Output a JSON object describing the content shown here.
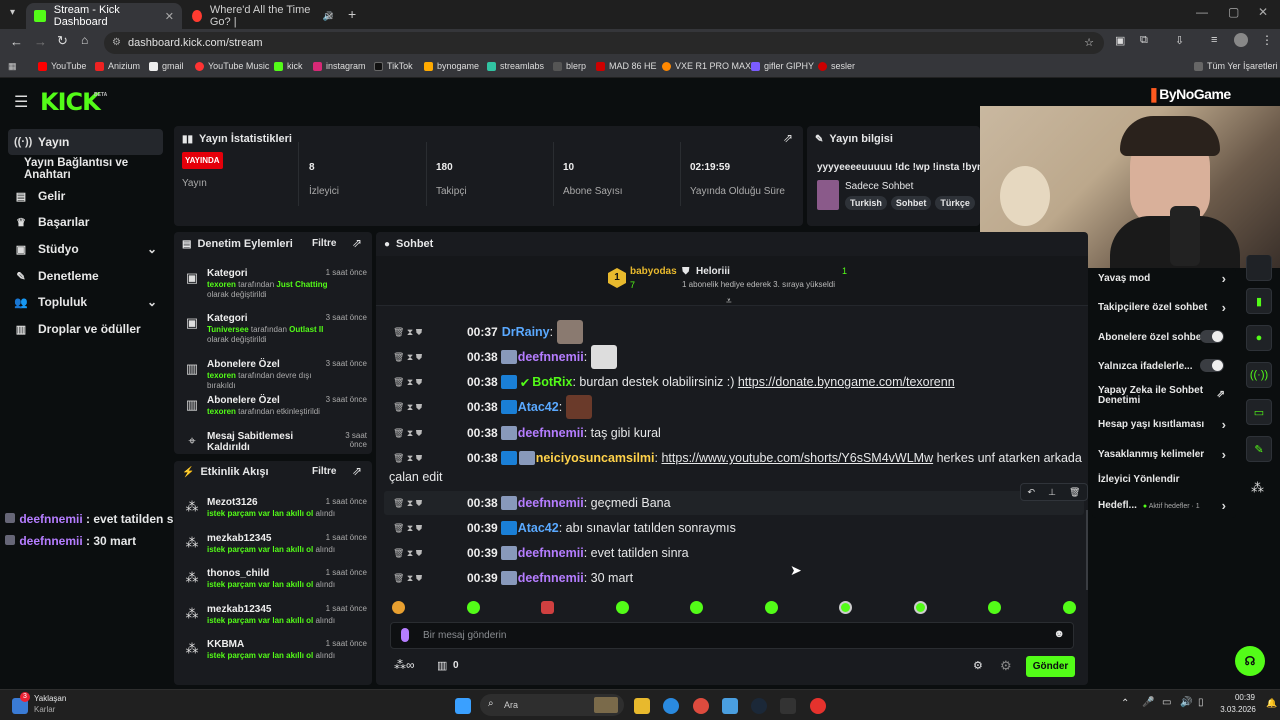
{
  "browser": {
    "tabs": [
      {
        "title": "Stream - Kick Dashboard",
        "color": "#53fc18"
      },
      {
        "title": "Where'd All the Time Go? |",
        "color": "#ff3b30"
      }
    ],
    "url": "dashboard.kick.com/stream",
    "bookmarks": [
      "YouTube",
      "Anizium",
      "gmail",
      "YouTube Music",
      "kick",
      "instagram",
      "TikTok",
      "bynogame",
      "streamlabs",
      "blerp",
      "MAD 86 HE",
      "VXE R1 PRO MAX",
      "gifler GIPHY",
      "sesler"
    ],
    "all_bookmarks": "Tüm Yer İşaretleri"
  },
  "header": {
    "logo": "KICK",
    "logo_tag": "BETA",
    "overlay_brand": "ByNoGame"
  },
  "sidebar": {
    "items": [
      {
        "label": "Yayın",
        "icon": "broadcast-icon"
      },
      {
        "label": "Yayın Bağlantısı ve Anahtarı"
      },
      {
        "label": "Gelir",
        "icon": "wallet-icon"
      },
      {
        "label": "Başarılar",
        "icon": "trophy-icon"
      },
      {
        "label": "Stüdyo",
        "icon": "studio-icon"
      },
      {
        "label": "Denetleme",
        "icon": "wrench-icon"
      },
      {
        "label": "Topluluk",
        "icon": "people-icon"
      },
      {
        "label": "Droplar ve ödüller",
        "icon": "gift-icon"
      }
    ]
  },
  "stats": {
    "title": "Yayın İstatistikleri",
    "live_badge": "YAYINDA",
    "live_label": "Yayın",
    "items": [
      {
        "value": "8",
        "label": "İzleyici"
      },
      {
        "value": "180",
        "label": "Takipçi"
      },
      {
        "value": "10",
        "label": "Abone Sayısı"
      },
      {
        "value": "02:19:59",
        "label": "Yayında Olduğu Süre"
      }
    ]
  },
  "info": {
    "title": "Yayın bilgisi",
    "stream_title": "yyyyeeeeuuuuu !dc !wp !insta !byno",
    "category": "Sadece Sohbet",
    "tags": [
      "Turkish",
      "Sohbet",
      "Türkçe"
    ]
  },
  "mod": {
    "title": "Denetim Eylemleri",
    "filter": "Filtre",
    "items": [
      {
        "title": "Kategori",
        "user": "texoren",
        "mid": " tarafından ",
        "target": "Just Chatting",
        "end": " olarak değiştirildi",
        "time": "1 saat önce"
      },
      {
        "title": "Kategori",
        "user": "Tuniversee",
        "mid": " tarafından ",
        "target": "Outlast II",
        "end": " olarak değiştirildi",
        "time": "3 saat önce"
      },
      {
        "title": "Abonelere Özel",
        "user": "texoren",
        "mid": " tarafından devre dışı bırakıldı",
        "target": "",
        "end": "",
        "time": "3 saat önce"
      },
      {
        "title": "Abonelere Özel",
        "user": "texoren",
        "mid": " tarafından etkinleştirildi",
        "target": "",
        "end": "",
        "time": "3 saat önce"
      },
      {
        "title": "Mesaj Sabitlemesi Kaldırıldı",
        "user": "",
        "mid": "",
        "target": "",
        "end": "",
        "time": "3 saat önce"
      }
    ]
  },
  "activity": {
    "title": "Etkinlik Akışı",
    "filter": "Filtre",
    "items": [
      {
        "name": "Mezot3126",
        "desc": "istek parçam var lan akıllı ol",
        "suffix": " alındı",
        "time": "1 saat önce"
      },
      {
        "name": "mezkab12345",
        "desc": "istek parçam var lan akıllı ol",
        "suffix": " alındı",
        "time": "1 saat önce"
      },
      {
        "name": "thonos_child",
        "desc": "istek parçam var lan akıllı ol",
        "suffix": " alındı",
        "time": "1 saat önce"
      },
      {
        "name": "mezkab12345",
        "desc": "istek parçam var lan akıllı ol",
        "suffix": " alındı",
        "time": "1 saat önce"
      },
      {
        "name": "KKBMA",
        "desc": "istek parçam var lan akıllı ol",
        "suffix": " alındı",
        "time": "1 saat önce"
      }
    ]
  },
  "overlay_chat": [
    {
      "user": "deefnnemii",
      "text": " : evet tatilden sinra"
    },
    {
      "user": "deefnnemii",
      "text": " : 30 mart"
    }
  ],
  "chat": {
    "title": "Sohbet",
    "leader1": {
      "rank": "1",
      "name": "babyodas",
      "count": "7"
    },
    "leader2": {
      "name": "Heloriii",
      "count": "1",
      "desc": "1 abonelik hediye ederek 3. sıraya yükseldi"
    },
    "messages": [
      {
        "time": "00:37",
        "user": "DrRainy",
        "color": "#5aa9ff",
        "text": "",
        "emote": true
      },
      {
        "time": "00:38",
        "user": "deefnnemii",
        "color": "#b57dff",
        "text": "",
        "emote": true
      },
      {
        "time": "00:38",
        "user": "BotRix",
        "color": "#53fc18",
        "text": " burdan destek olabilirsiniz :) ",
        "link": "https://donate.bynogame.com/texorenn"
      },
      {
        "time": "00:38",
        "user": "Atac42",
        "color": "#5aa9ff",
        "text": "",
        "emote": true
      },
      {
        "time": "00:38",
        "user": "deefnnemii",
        "color": "#b57dff",
        "text": " taş gibi kural"
      },
      {
        "time": "00:38",
        "user": "neiciyosuncamsilmi",
        "color": "#ffd24a",
        "text": " ",
        "link": "https://www.youtube.com/shorts/Y6sSM4vWLMw",
        "after": " herkes unf atarken arkada",
        "wrap": "çalan edit"
      },
      {
        "time": "00:38",
        "user": "deefnnemii",
        "color": "#b57dff",
        "text": " geçmedi Bana"
      },
      {
        "time": "00:39",
        "user": "Atac42",
        "color": "#5aa9ff",
        "text": " abı sınavlar tatılden sonraymıs"
      },
      {
        "time": "00:39",
        "user": "deefnnemii",
        "color": "#b57dff",
        "text": " evet tatilden sinra"
      },
      {
        "time": "00:39",
        "user": "deefnnemii",
        "color": "#b57dff",
        "text": " 30 mart"
      }
    ],
    "input_placeholder": "Bir mesaj gönderin",
    "points": "0",
    "send": "Gönder"
  },
  "settings": [
    {
      "label": "Yavaş mod",
      "type": "arrow"
    },
    {
      "label": "Takipçilere özel sohbet",
      "type": "arrow"
    },
    {
      "label": "Abonelere özel sohbet",
      "type": "toggle"
    },
    {
      "label": "Yalnızca ifadelerle...",
      "type": "toggle"
    },
    {
      "label": "Yapay Zeka ile Sohbet Denetimi",
      "type": "ext"
    },
    {
      "label": "Hesap yaşı kısıtlaması",
      "type": "arrow"
    },
    {
      "label": "Yasaklanmış kelimeler",
      "type": "arrow"
    },
    {
      "label": "İzleyici Yönlendir",
      "type": "none"
    },
    {
      "label": "Hedefl...",
      "type": "arrow",
      "extra": "Aktif hedefler · 1"
    }
  ],
  "taskbar": {
    "weather_title": "Yaklaşan",
    "weather_sub": "Karlar",
    "search": "Ara",
    "time": "00:39",
    "date": "3.03.2026",
    "notif": "3"
  }
}
